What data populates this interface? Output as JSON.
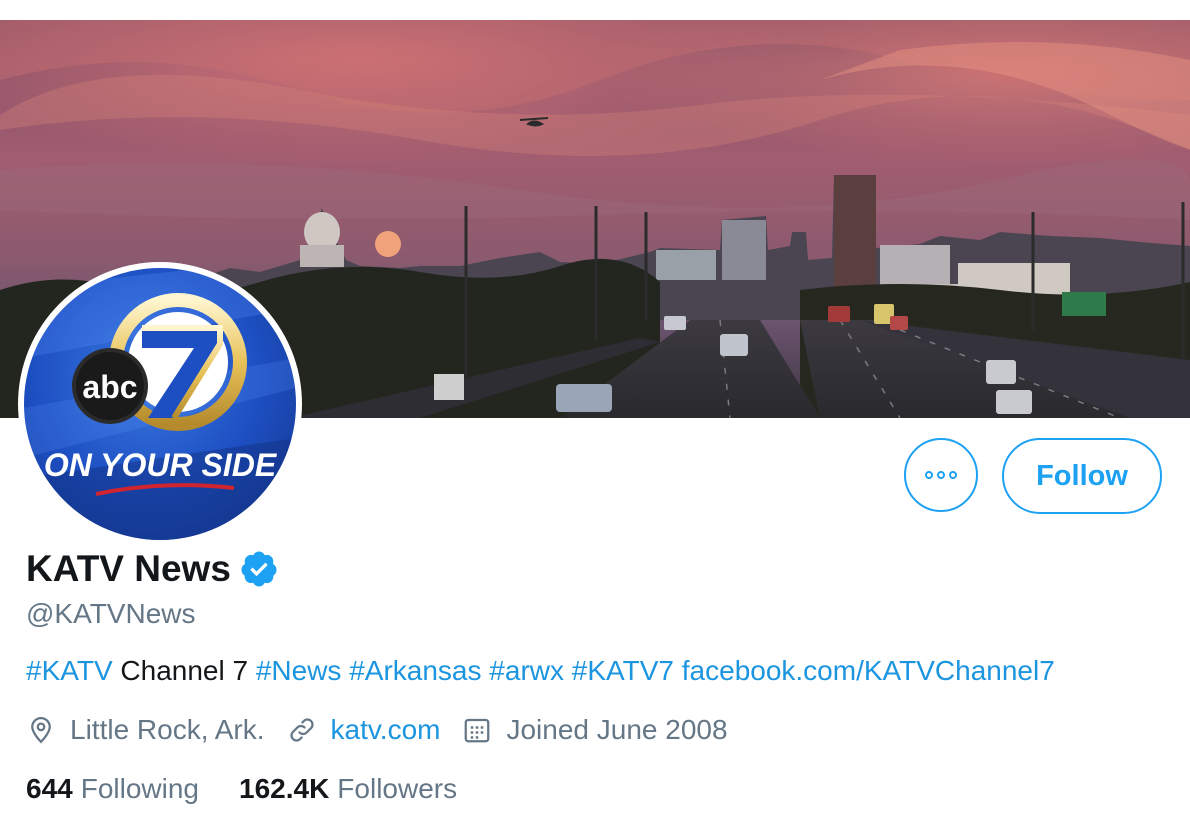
{
  "profile": {
    "display_name": "KATV News",
    "handle": "@KATVNews",
    "verified": true,
    "avatar_text": {
      "brand": "abc",
      "channel": "7",
      "slogan": "ON YOUR SIDE"
    }
  },
  "actions": {
    "more_icon": "more-icon",
    "follow_label": "Follow"
  },
  "bio": {
    "parts": [
      {
        "text": "#KATV",
        "link": true
      },
      {
        "text": " Channel 7 ",
        "link": false
      },
      {
        "text": "#News",
        "link": true
      },
      {
        "text": " ",
        "link": false
      },
      {
        "text": "#Arkansas",
        "link": true
      },
      {
        "text": " ",
        "link": false
      },
      {
        "text": "#arwx",
        "link": true
      },
      {
        "text": " ",
        "link": false
      },
      {
        "text": "#KATV7",
        "link": true
      },
      {
        "text": " ",
        "link": false
      },
      {
        "text": "facebook.com/KATVChannel7",
        "link": true
      }
    ]
  },
  "meta": {
    "location": "Little Rock, Ark.",
    "location_icon": "location-pin-icon",
    "website": "katv.com",
    "website_icon": "link-icon",
    "joined": "Joined June 2008",
    "joined_icon": "calendar-icon"
  },
  "stats": {
    "following_count": "644",
    "following_label": "Following",
    "followers_count": "162.4K",
    "followers_label": "Followers"
  },
  "colors": {
    "accent": "#1da1f2",
    "link": "#1b95e0",
    "secondary_text": "#657786",
    "primary_text": "#14171a"
  }
}
